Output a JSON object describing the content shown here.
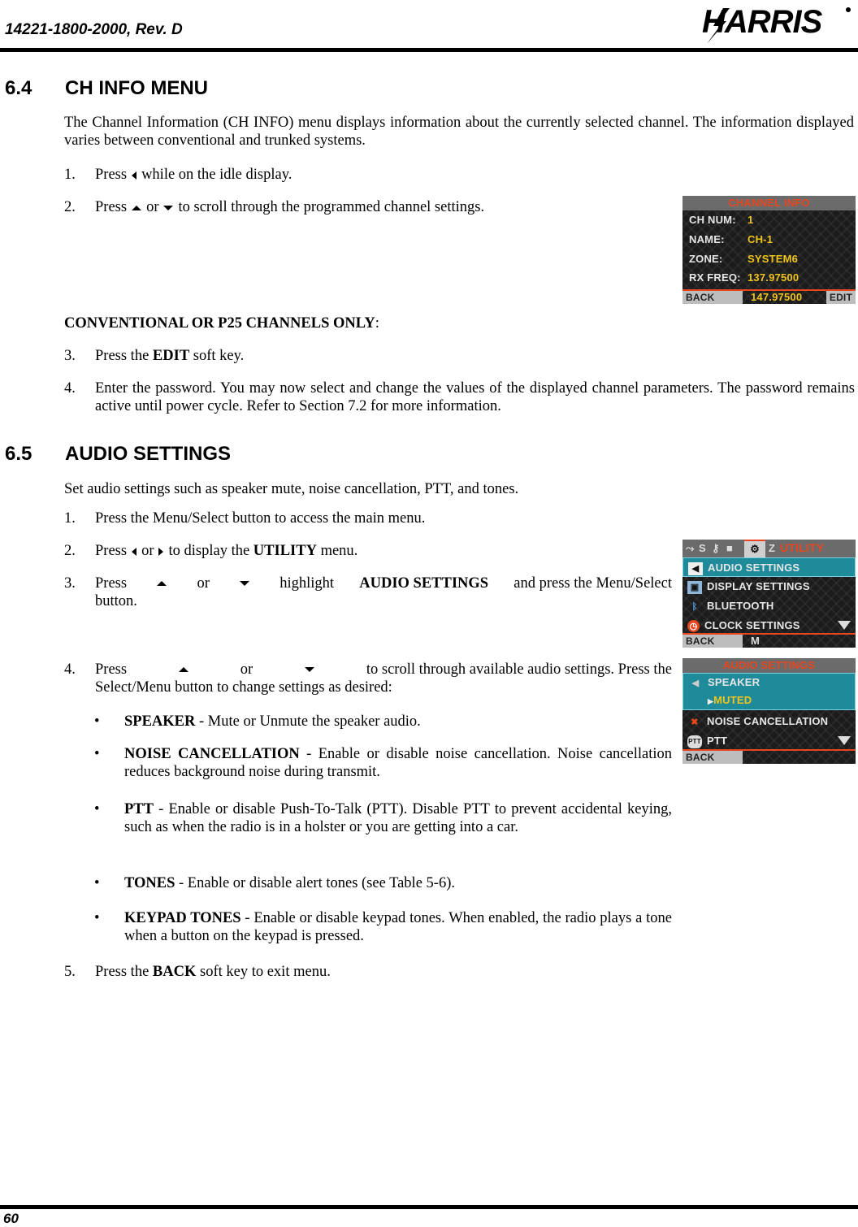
{
  "header": {
    "doc_number": "14221-1800-2000, Rev. D",
    "logo_text": "HARRIS"
  },
  "footer": {
    "page_number": "60"
  },
  "section_6_4": {
    "number": "6.4",
    "title": "CH INFO MENU",
    "intro": "The Channel Information (CH INFO) menu displays information about the currently selected channel. The information displayed varies between conventional and trunked systems.",
    "steps": [
      {
        "n": "1.",
        "pre": "Press",
        "post": "while on the idle display."
      },
      {
        "n": "2.",
        "pre": "Press",
        "mid": "or",
        "post": "to scroll through the programmed channel settings."
      }
    ],
    "conventional_heading": "CONVENTIONAL OR P25 CHANNELS ONLY",
    "conventional_colon": ":",
    "steps2": [
      {
        "n": "3.",
        "pre": "Press the ",
        "bold": "EDIT",
        "post": " soft key."
      },
      {
        "n": "4.",
        "text": "Enter the password. You may now select and change the values of the displayed channel parameters. The password remains active until power cycle. Refer to Section 7.2 for more information."
      }
    ],
    "screen": {
      "title": "CHANNEL INFO",
      "rows": [
        {
          "label": "CH NUM:",
          "value": "1"
        },
        {
          "label": "NAME:",
          "value": "CH-1"
        },
        {
          "label": "ZONE:",
          "value": "SYSTEM6"
        },
        {
          "label": "RX FREQ:",
          "value": "137.97500"
        }
      ],
      "tx_value": "147.97500",
      "soft_left": "BACK",
      "soft_right": "EDIT"
    }
  },
  "section_6_5": {
    "number": "6.5",
    "title": "AUDIO SETTINGS",
    "intro": "Set audio settings such as speaker mute, noise cancellation, PTT, and tones.",
    "steps": [
      {
        "n": "1.",
        "text": "Press the Menu/Select button to access the main menu."
      },
      {
        "n": "2.",
        "pre": "Press",
        "mid": "or",
        "post": "to display the ",
        "bold": "UTILITY",
        "end": " menu."
      },
      {
        "n": "3.",
        "pre": "Press",
        "mid": "or",
        "post": "highlight",
        "bold": "AUDIO SETTINGS",
        "end": "and press the Menu/Select",
        "line2": "button."
      },
      {
        "n": "4.",
        "pre": "Press",
        "mid": "or",
        "post": "to scroll through available audio settings. Press the",
        "line2": "Select/Menu button to change settings as desired:"
      },
      {
        "n": "5.",
        "pre": "Press the ",
        "bold": "BACK",
        "post": " soft key to exit menu."
      }
    ],
    "bullets": [
      {
        "bold": "SPEAKER",
        "text": " - Mute or Unmute the speaker audio."
      },
      {
        "bold": "NOISE CANCELLATION",
        "text": " - Enable or disable noise cancellation. Noise cancellation reduces background noise during transmit."
      },
      {
        "bold": "PTT",
        "text": " - Enable or disable Push-To-Talk (PTT). Disable PTT to prevent accidental keying, such as when the radio is in a holster or you are getting into a car."
      },
      {
        "bold": "TONES",
        "text": " - Enable or disable alert tones (see Table 5-6)."
      },
      {
        "bold": "KEYPAD TONES",
        "text": " - Enable or disable keypad tones. When enabled, the radio plays a tone when a button on the keypad is pressed."
      }
    ],
    "bullet_glyph": "•",
    "utility_screen": {
      "tab_title": "UTILITY",
      "items": [
        {
          "icon": "speaker-icon",
          "label": "AUDIO SETTINGS",
          "selected": true
        },
        {
          "icon": "display-icon",
          "label": "DISPLAY SETTINGS"
        },
        {
          "icon": "bluetooth-icon",
          "label": "BLUETOOTH"
        },
        {
          "icon": "clock-icon",
          "label": "CLOCK SETTINGS"
        }
      ],
      "soft_left": "BACK",
      "soft_mid": "M"
    },
    "audio_screen": {
      "title": "AUDIO SETTINGS",
      "items": [
        {
          "label": "SPEAKER",
          "sub": "MUTED",
          "selected": true
        },
        {
          "label": "NOISE CANCELLATION"
        },
        {
          "label": "PTT"
        }
      ],
      "soft_left": "BACK"
    }
  },
  "colors": {
    "accent_orange": "#e8461e",
    "value_yellow": "#f0c419",
    "highlight_teal": "#1e8a9a"
  }
}
